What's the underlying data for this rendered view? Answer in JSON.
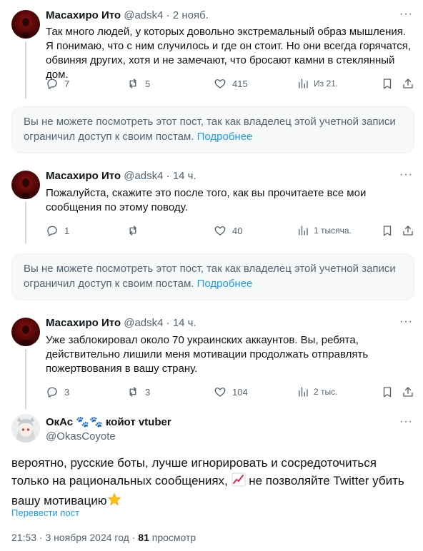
{
  "tweets": [
    {
      "author_name": "Масахиро Ито",
      "handle": "@adsk4",
      "time": "2 нояб.",
      "text": "Так много людей, у которых довольно экстремальный образ мышления. Я понимаю, что с ним случилось и где он стоит. Но они всегда горячатся, обвиняя других, хотя и не замечают, что бросают камни в стеклянный дом.",
      "replies": "7",
      "reposts": "5",
      "likes": "415",
      "views": "Из 21."
    },
    {
      "author_name": "Масахиро Ито",
      "handle": "@adsk4",
      "time": "14 ч.",
      "text": "Пожалуйста, скажите это после того, как вы прочитаете все мои сообщения по этому поводу.",
      "replies": "1",
      "reposts": "",
      "likes": "40",
      "views": "1 тысяча."
    },
    {
      "author_name": "Масахиро Ито",
      "handle": "@adsk4",
      "time": "14 ч.",
      "text": "Уже заблокировал около 70 украинских аккаунтов. Вы, ребята, действительно лишили меня мотивации продолжать отправлять пожертвования в вашу страну.",
      "replies": "3",
      "reposts": "3",
      "likes": "104",
      "views": "2 тыс."
    }
  ],
  "notices": [
    {
      "text": "Вы не можете посмотреть этот пост, так как владелец этой учетной записи ограничил доступ к своим постам. ",
      "link": "Подробнее"
    },
    {
      "text": "Вы не можете посмотреть этот пост, так как владелец этой учетной записи ограничил доступ к своим постам. ",
      "link": "Подробнее"
    }
  ],
  "separator": " · ",
  "more_glyph": "···",
  "main_post": {
    "author_name": "ОкАс 🐾🐾 койот vtuber",
    "handle": "@OkasCoyote",
    "text_part1": "вероятно, русские боты, лучше игнорировать и сосредоточиться только на рациональных сообщениях, ",
    "text_part2": " не позволяйте Twitter убить вашу мотивацию",
    "translate_label": "Перевести пост",
    "timestamp": "21:53 · 3 ноября 2024 год · ",
    "views_count": "81",
    "views_label": " просмотр"
  },
  "colors": {
    "link": "#1d9bf0",
    "muted": "#536471",
    "text": "#0f1419",
    "notice_bg": "#f7f9f9"
  },
  "icons": [
    "reply-icon",
    "repost-icon",
    "like-icon",
    "views-icon",
    "bookmark-icon",
    "share-icon",
    "more-icon",
    "chart-emoji-icon",
    "star-emoji-icon"
  ]
}
